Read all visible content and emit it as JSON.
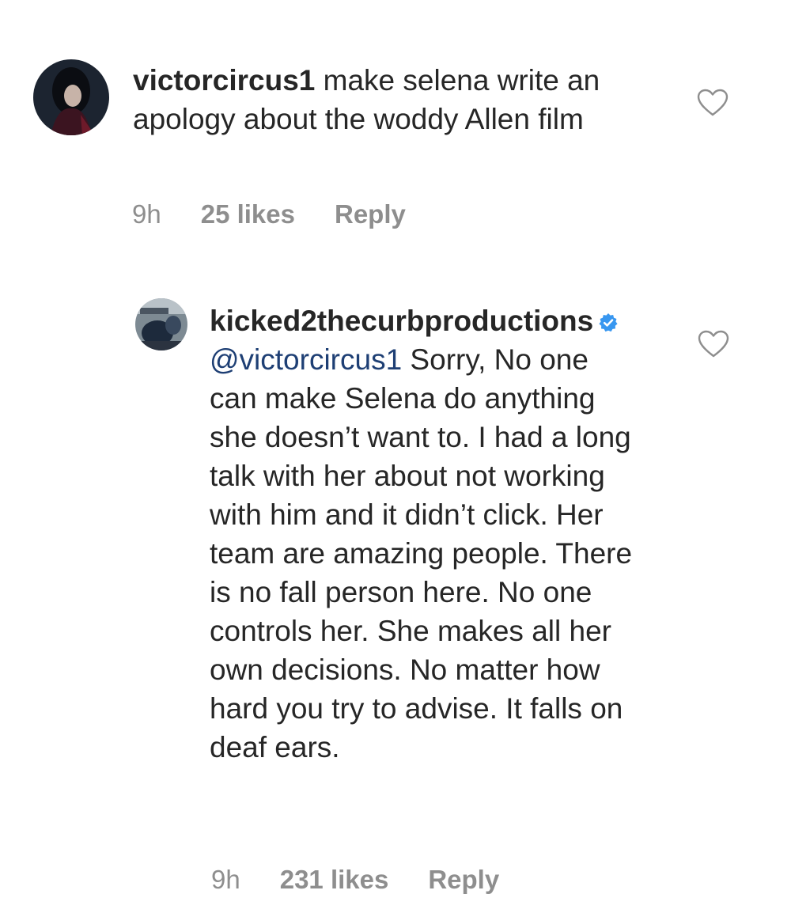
{
  "comments": [
    {
      "username": "victorcircus1",
      "text": " make selena write an apology about the woddy Allen film",
      "time": "9h",
      "likes": "25 likes",
      "reply_label": "Reply",
      "avatar_icon": "profile-photo-dark",
      "like_icon": "heart-outline-icon"
    },
    {
      "username": "kicked2thecurbproductions",
      "verified_icon": "verified-badge-icon",
      "mention": "@victorcircus1",
      "text": " Sorry, No one can make Selena do anything she doesn’t want to. I had a long talk with her about not working with him and it didn’t click. Her team are amazing people. There is no fall person here. No one controls her. She makes all her own decisions. No matter how hard you try to advise. It falls on deaf ears.",
      "time": "9h",
      "likes": "231 likes",
      "reply_label": "Reply",
      "avatar_icon": "profile-photo-outdoor",
      "like_icon": "heart-outline-icon"
    }
  ],
  "colors": {
    "text": "#262626",
    "meta": "#8e8e8e",
    "mention": "#1e3f74",
    "verified": "#3897f0"
  }
}
